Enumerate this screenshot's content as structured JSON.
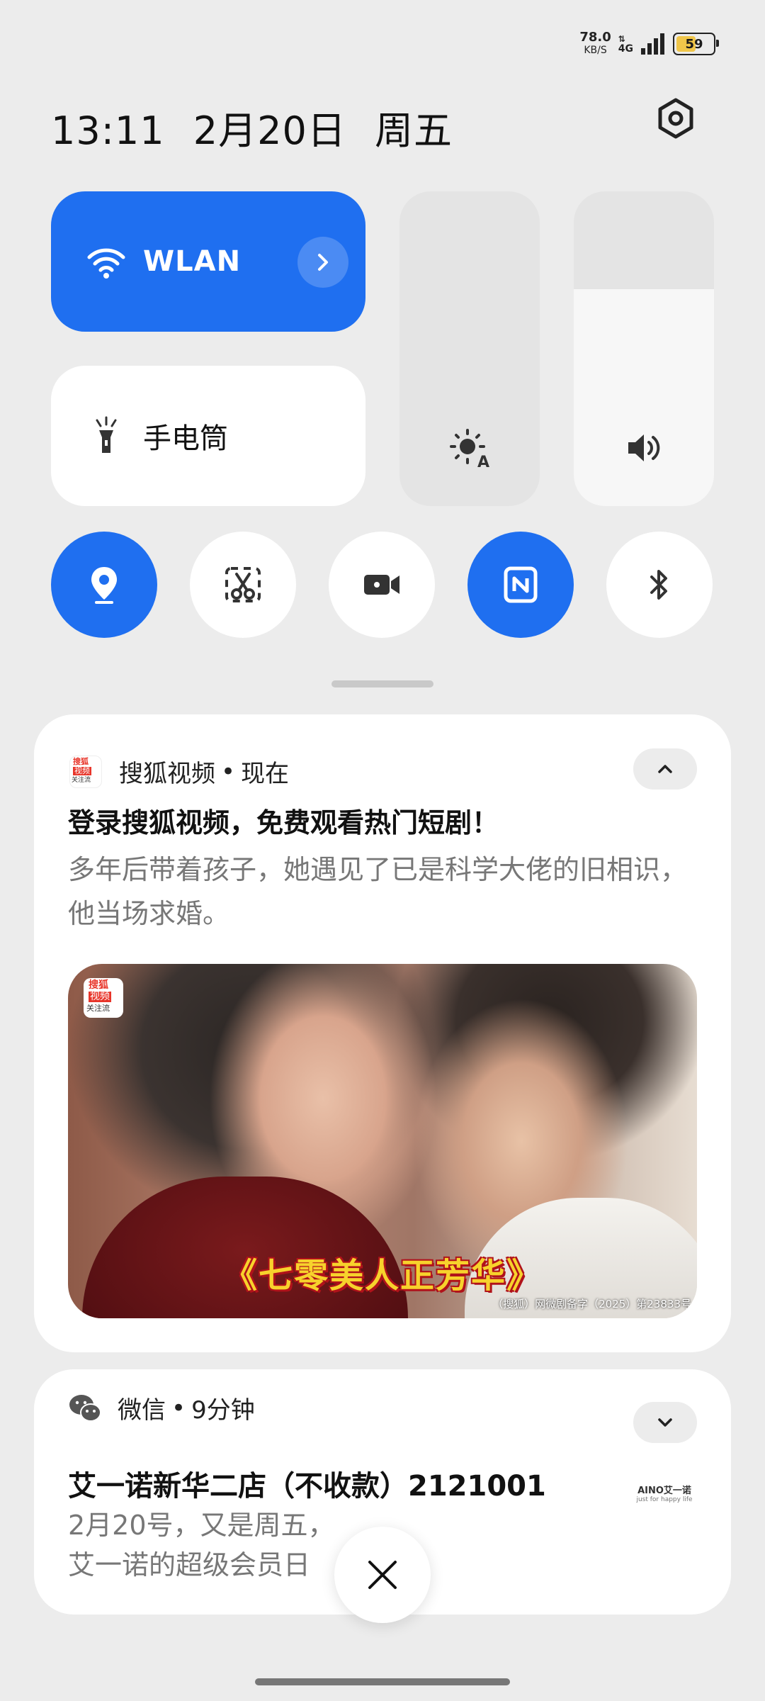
{
  "status_bar": {
    "net_speed": "78.0",
    "net_unit": "KB/S",
    "network_type": "4G",
    "battery_percent": "59",
    "battery_color": "#f0c64a"
  },
  "header": {
    "time": "13:11",
    "date": "2月20日",
    "weekday": "周五",
    "settings_icon": "gear-icon"
  },
  "quick_settings": {
    "accent_color": "#1f6ff0",
    "wlan": {
      "label": "WLAN",
      "on": true
    },
    "flashlight": {
      "label": "手电筒",
      "on": false
    },
    "brightness_level": 0,
    "volume_level": 0.69,
    "toggles": [
      {
        "name": "location",
        "icon": "location-pin-icon",
        "on": true
      },
      {
        "name": "screenshot",
        "icon": "scissors-icon",
        "on": false
      },
      {
        "name": "screen-record",
        "icon": "video-camera-icon",
        "on": false
      },
      {
        "name": "nfc",
        "icon": "nfc-icon",
        "on": true
      },
      {
        "name": "bluetooth",
        "icon": "bluetooth-icon",
        "on": false
      }
    ]
  },
  "notifications": [
    {
      "app_icon": {
        "line1": "搜狐",
        "line2": "视频",
        "line3": "关注流"
      },
      "app_name": "搜狐视频",
      "time": "现在",
      "title": "登录搜狐视频，免费观看热门短剧！",
      "body": "多年后带着孩子，她遇见了已是科学大佬的旧相识，他当场求婚。",
      "image": {
        "title_text": "《七零美人正芳华》",
        "note_text": "（搜狐）网微剧备字（2025）第23833号",
        "logo": {
          "line1": "搜狐",
          "line2": "视频",
          "line3": "关注流"
        }
      },
      "expanded": true
    },
    {
      "app_name": "微信",
      "time": "9分钟",
      "title": "艾一诺新华二店（不收款）2121001",
      "body_line1": "2月20号，又是周五，",
      "body_line2": "艾一诺的超级会员日",
      "thumb_text": "AINO艾一诺",
      "thumb_sub": "just for happy life",
      "expanded": false
    }
  ],
  "dismiss_icon": "close-icon"
}
